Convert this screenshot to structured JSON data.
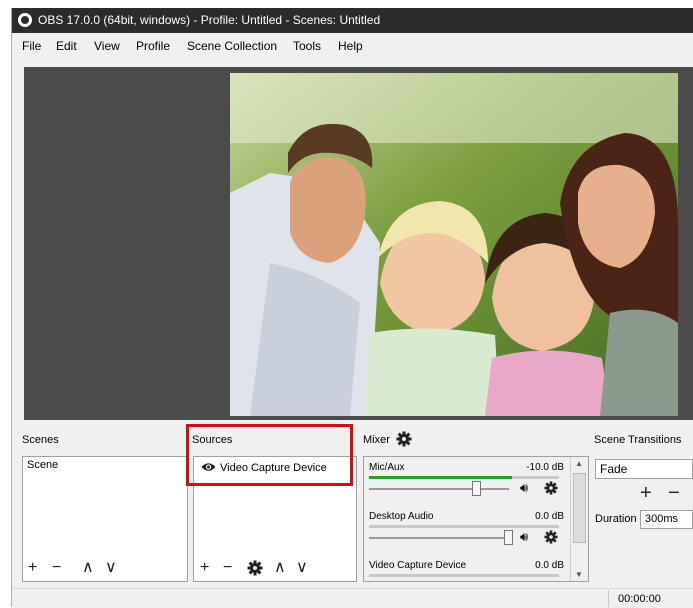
{
  "window": {
    "title": "OBS 17.0.0 (64bit, windows) - Profile: Untitled - Scenes: Untitled"
  },
  "menu": [
    "File",
    "Edit",
    "View",
    "Profile",
    "Scene Collection",
    "Tools",
    "Help"
  ],
  "scenes": {
    "title": "Scenes",
    "items": [
      "Scene"
    ],
    "toolbar": {
      "add": "+",
      "remove": "−",
      "up": "∧",
      "down": "∨"
    }
  },
  "sources": {
    "title": "Sources",
    "items": [
      {
        "label": "Video Capture Device",
        "visible_icon": "eye-icon"
      }
    ],
    "toolbar": {
      "add": "+",
      "remove": "−",
      "up": "∧",
      "down": "∨"
    }
  },
  "mixer": {
    "title": "Mixer",
    "title_icon": "gear-icon",
    "channels": [
      {
        "name": "Mic/Aux",
        "db": "-10.0 dB",
        "meter_level": 0.75,
        "volume": 0.77
      },
      {
        "name": "Desktop Audio",
        "db": "0.0 dB",
        "meter_level": 0,
        "volume": 1.0
      },
      {
        "name": "Video Capture Device",
        "db": "0.0 dB",
        "meter_level": 0,
        "volume": 1.0
      }
    ]
  },
  "transitions": {
    "title": "Scene Transitions",
    "selected": "Fade",
    "add": "+",
    "remove": "−",
    "duration_label": "Duration",
    "duration_value": "300ms"
  },
  "status": {
    "time": "00:00:00"
  },
  "colors": {
    "highlight": "#d01010",
    "preview_bg": "#4b4b4b",
    "meter_green": "#28a028"
  }
}
